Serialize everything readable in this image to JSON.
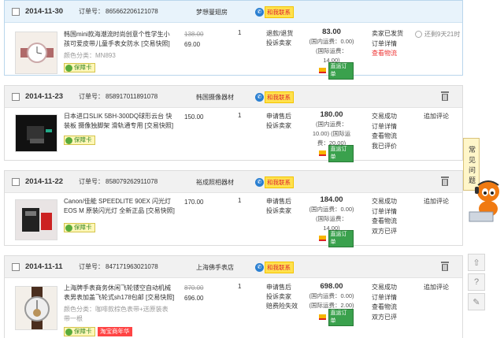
{
  "orders": [
    {
      "date": "2014-11-30",
      "order_label": "订单号：",
      "order_no": "865662206121078",
      "shop": "梦想曼翅房",
      "contact": "和我联系",
      "title": "韩国mini款海潮流时尚创意个性学生小孩可爱皮带儿童手表女防水 [交易快照]",
      "spec": "颜色分类：MN893",
      "badges": [
        "保障卡"
      ],
      "orig_price": "138.00",
      "price": "69.00",
      "qty": "1",
      "services": [
        "退款/退货",
        "投诉卖家"
      ],
      "total": "83.00",
      "ship_note": [
        "(国内运费：0.00)",
        "(国际运费：",
        "14.00)"
      ],
      "pay_label": "直运订单",
      "status": [
        "卖家已发货",
        "订单详情",
        "查看物流"
      ],
      "status_red_index": 2,
      "timer": "还剩9天21时"
    },
    {
      "date": "2014-11-23",
      "order_label": "订单号：",
      "order_no": "858917011891078",
      "shop": "韩国摄像器材",
      "contact": "和我联系",
      "title": "日本进口SLIK 5BH-300DQ球形云台 快装板 摄像独脚架 滑轨通专用 [交易快照]",
      "spec": "",
      "badges": [
        "保障卡"
      ],
      "orig_price": "",
      "price": "150.00",
      "qty": "1",
      "services": [
        "申请售后",
        "投诉卖家"
      ],
      "total": "180.00",
      "ship_note": [
        "(国内运费：",
        "10.00) (国际运",
        "费：20.00)"
      ],
      "pay_label": "直运订单",
      "status": [
        "交易成功",
        "订单详情",
        "查看物流",
        "我已评价"
      ],
      "status_red_index": -1,
      "ops": "追加评论"
    },
    {
      "date": "2014-11-22",
      "order_label": "订单号：",
      "order_no": "858079262911078",
      "shop": "裕成照相器材",
      "contact": "和我联系",
      "title": "Canon/佳能 SPEEDLITE 90EX 闪光灯 EOS M 原装闪光灯 全新正品 [交易快照]",
      "spec": "",
      "badges": [
        "保障卡"
      ],
      "orig_price": "",
      "price": "170.00",
      "qty": "1",
      "services": [
        "申请售后",
        "投诉卖家"
      ],
      "total": "184.00",
      "ship_note": [
        "(国内运费：0.00)",
        "(国际运费：",
        "14.00)"
      ],
      "pay_label": "直运订单",
      "status": [
        "交易成功",
        "订单详情",
        "查看物流",
        "双方已评"
      ],
      "status_red_index": -1,
      "ops": "追加评论"
    },
    {
      "date": "2014-11-11",
      "order_label": "订单号：",
      "order_no": "847171963021078",
      "shop": "上海佛手表店",
      "contact": "和我联系",
      "title": "上海牌手表商务休闲飞轮镂空自动机械表男表加盖飞轮式sh178包邮 [交易快照]",
      "spec": "颜色分类：咖啡款棕色表带+送原装表带一根",
      "badges": [
        "保障卡",
        "淘宝商年华"
      ],
      "orig_price": "870.00",
      "price": "696.00",
      "qty": "1",
      "services": [
        "申请售后",
        "投诉卖家",
        "赔费险失效"
      ],
      "total": "698.00",
      "ship_note": [
        "(国内运费：0.00)",
        "(国际运费：2.00)"
      ],
      "pay_label": "直运订单",
      "status": [
        "交易成功",
        "订单详情",
        "查看物流",
        "双方已评"
      ],
      "status_red_index": -1,
      "ops": "追加评论"
    }
  ],
  "sidebar": {
    "faq_label": "常见问题",
    "tools": [
      "top-icon",
      "help-icon",
      "edit-icon"
    ]
  },
  "colors": {
    "accent_red": "#e33333",
    "pay_green": "#3aa14d",
    "head_blue": "#e8f3fb"
  }
}
